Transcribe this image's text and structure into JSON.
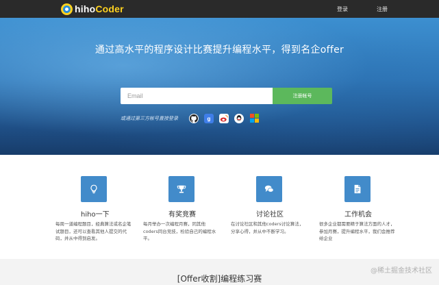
{
  "nav": {
    "logo_prefix": "hiho",
    "logo_suffix": "Coder",
    "login": "登录",
    "register": "注册"
  },
  "hero": {
    "title": "通过高水平的程序设计比赛提升编程水平，得到名企offer",
    "email_placeholder": "Email",
    "signup_button": "注册帐号",
    "third_party_text": "或通过第三方帐号直接登录",
    "social_icons": [
      "github-icon",
      "google-icon",
      "weibo-icon",
      "qq-icon",
      "microsoft-icon"
    ]
  },
  "features": [
    {
      "icon": "lightbulb-icon",
      "title": "hiho一下",
      "desc": "每周一道编程题目，经典算法或名企笔试题目，还可以查看其他人提交的代码，并从中得到启发。"
    },
    {
      "icon": "trophy-icon",
      "title": "有奖竞赛",
      "desc": "每月举办一次编程月赛，同其他coders同台竞技，检验自己的编程水平。"
    },
    {
      "icon": "chat-icon",
      "title": "讨论社区",
      "desc": "在讨论社区和其他coders讨论算法，分享心得，并从中不断学习。"
    },
    {
      "icon": "document-icon",
      "title": "工作机会",
      "desc": "很多企业都需要精于算法方面的人才，参加月赛，提升编程水平，我们会推荐给企业"
    }
  ],
  "bottom": {
    "title": "[Offer收割]编程练习赛",
    "watermark": "@稀土掘金技术社区"
  },
  "colors": {
    "nav_bg": "#2a2a2a",
    "signup_green": "#5cb85c",
    "feature_blue": "#428bca"
  }
}
